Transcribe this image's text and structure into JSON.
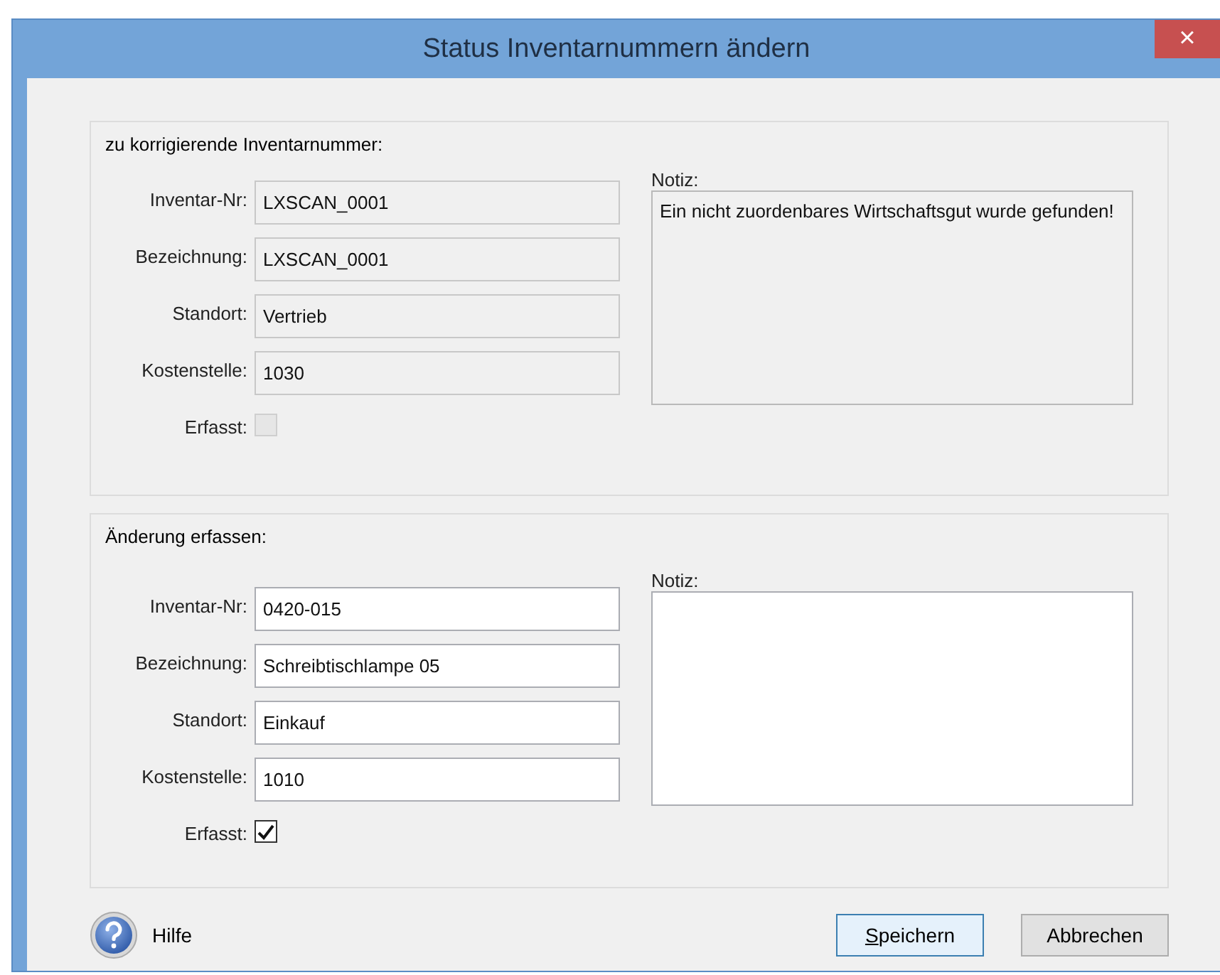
{
  "window": {
    "title": "Status Inventarnummern ändern",
    "close": "×"
  },
  "groups": [
    {
      "title": "zu korrigierende Inventarnummer:",
      "editable": false,
      "fields": [
        {
          "label": "Inventar-Nr:",
          "value": "LXSCAN_0001"
        },
        {
          "label": "Bezeichnung:",
          "value": "LXSCAN_0001"
        },
        {
          "label": "Standort:",
          "value": "Vertrieb"
        },
        {
          "label": "Kostenstelle:",
          "value": "1030"
        }
      ],
      "checkbox": {
        "label": "Erfasst:",
        "checked": false,
        "disabled": true
      },
      "note": {
        "label": "Notiz:",
        "value": "Ein nicht zuordenbares Wirtschaftsgut wurde gefunden!"
      }
    },
    {
      "title": "Änderung erfassen:",
      "editable": true,
      "fields": [
        {
          "label": "Inventar-Nr:",
          "value": "0420-015"
        },
        {
          "label": "Bezeichnung:",
          "value": "Schreibtischlampe 05"
        },
        {
          "label": "Standort:",
          "value": "Einkauf"
        },
        {
          "label": "Kostenstelle:",
          "value": "1010"
        }
      ],
      "checkbox": {
        "label": "Erfasst:",
        "checked": true,
        "disabled": false
      },
      "note": {
        "label": "Notiz:"
      }
    }
  ],
  "help": {
    "label": "Hilfe"
  },
  "buttons": [
    {
      "label": "Speichern",
      "first_letter_underlined": true,
      "default": true
    },
    {
      "label": "Abbrechen",
      "first_letter_underlined": false,
      "default": false
    }
  ]
}
